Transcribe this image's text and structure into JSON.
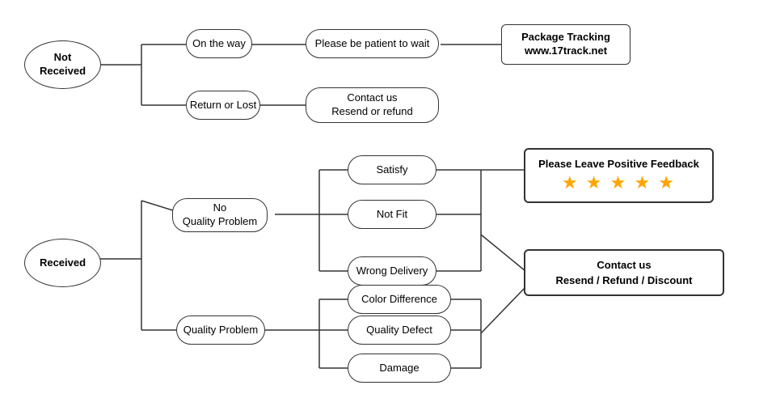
{
  "nodes": {
    "not_received": {
      "label": "Not\nReceived"
    },
    "on_the_way": {
      "label": "On the way"
    },
    "return_or_lost": {
      "label": "Return or Lost"
    },
    "be_patient": {
      "label": "Please be patient to wait"
    },
    "package_tracking": {
      "label": "Package Tracking\nwww.17track.net"
    },
    "contact_resend_refund": {
      "label": "Contact us\nResend or refund"
    },
    "received": {
      "label": "Received"
    },
    "no_quality_problem": {
      "label": "No\nQuality Problem"
    },
    "quality_problem": {
      "label": "Quality Problem"
    },
    "satisfy": {
      "label": "Satisfy"
    },
    "not_fit": {
      "label": "Not Fit"
    },
    "wrong_delivery": {
      "label": "Wrong Delivery"
    },
    "color_difference": {
      "label": "Color Difference"
    },
    "quality_defect": {
      "label": "Quality Defect"
    },
    "damage": {
      "label": "Damage"
    },
    "positive_feedback": {
      "label": "Please Leave Positive Feedback"
    },
    "stars": {
      "label": "★ ★ ★ ★ ★"
    },
    "contact_refund_discount": {
      "label": "Contact us\nResend / Refund / Discount"
    }
  }
}
